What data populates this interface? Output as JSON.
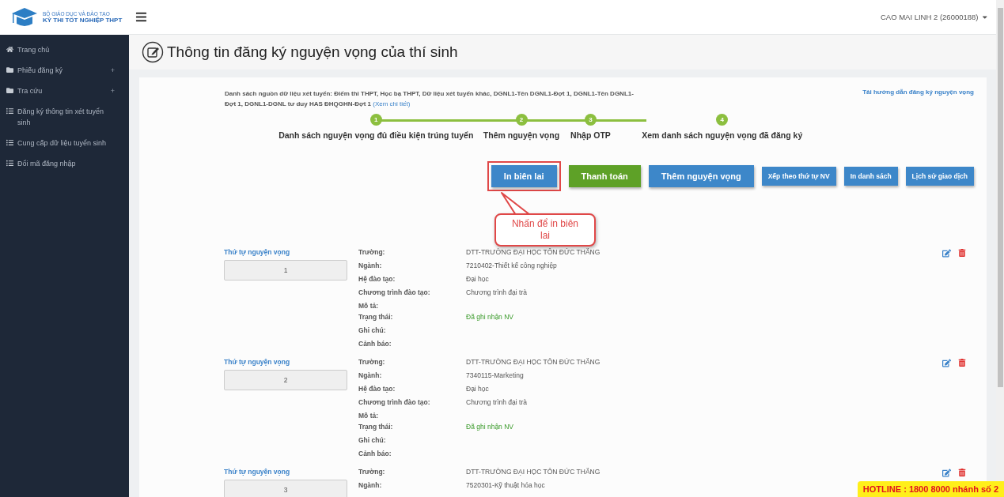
{
  "logo": {
    "ministry": "BỘ GIÁO DỤC VÀ ĐÀO TẠO",
    "exam": "KỲ THI TỐT NGHIỆP THPT"
  },
  "sidebar": {
    "items": [
      {
        "label": "Trang chủ",
        "kind": "home"
      },
      {
        "label": "Phiếu đăng ký",
        "kind": "folder",
        "toggle": "+"
      },
      {
        "label": "Tra cứu",
        "kind": "folder",
        "toggle": "+"
      },
      {
        "label": "Đăng ký thông tin xét tuyển sinh",
        "kind": "list"
      },
      {
        "label": "Cung cấp dữ liệu tuyển sinh",
        "kind": "list"
      },
      {
        "label": "Đổi mã đăng nhập",
        "kind": "list"
      }
    ]
  },
  "header": {
    "user": "CAO MAI LINH 2 (26000188)"
  },
  "page_title": "Thông tin đăng ký nguyện vọng của thí sinh",
  "sources": {
    "text": "Danh sách nguồn dữ liệu xét tuyển: Điểm thi THPT, Học bạ THPT, Dữ liệu xét tuyển khác, DGNL1-Tên DGNL1-Đợt 1, DGNL1-Tên DGNL1-Đợt 1, DGNL1-DGNL tư duy HAS ĐHQGHN-Đợt 1",
    "link": "(Xem chi tiết)"
  },
  "guide_link": "Tải hướng dẫn đăng ký nguyện vọng",
  "steps": [
    {
      "number": "1",
      "label": "Danh sách nguyện vọng đủ điều kiện trúng tuyển",
      "completed": true
    },
    {
      "number": "2",
      "label": "Thêm nguyện vọng",
      "completed": true
    },
    {
      "number": "3",
      "label": "Nhập OTP",
      "completed": true
    },
    {
      "number": "4",
      "label": "Xem danh sách nguyện vọng đã đăng ký",
      "completed": true
    }
  ],
  "buttons": [
    {
      "label": "In biên lai",
      "kind": "primary",
      "highlighted": true
    },
    {
      "label": "Thanh toán",
      "kind": "success",
      "highlighted": false
    },
    {
      "label": "Thêm nguyện vọng",
      "kind": "primary",
      "highlighted": false
    },
    {
      "label": "Xếp theo thứ tự NV",
      "kind": "compact",
      "highlighted": false
    },
    {
      "label": "In danh sách",
      "kind": "compact",
      "highlighted": false
    },
    {
      "label": "Lịch sử giao dịch",
      "kind": "compact",
      "highlighted": false
    }
  ],
  "callout": "Nhấn để in biên lai",
  "wishes": [
    {
      "order_label": "Thứ tự nguyện vọng",
      "order": "1",
      "fields": [
        {
          "label": "Trường:",
          "value": "DTT-TRƯỜNG ĐẠI HỌC TÔN ĐỨC THẮNG"
        },
        {
          "label": "Ngành:",
          "value": "7210402-Thiết kế công nghiệp"
        },
        {
          "label": "Hệ đào tạo:",
          "value": "Đại học"
        },
        {
          "label": "Chương trình đào tạo:",
          "value": "Chương trình đại trà"
        },
        {
          "label": "Mô tả:"
        },
        {
          "label": "Trạng thái:",
          "value": "Đã ghi nhận NV",
          "kind": "status"
        },
        {
          "label": "Ghi chú:"
        },
        {
          "label": "Cảnh báo:"
        }
      ]
    },
    {
      "order_label": "Thứ tự nguyện vọng",
      "order": "2",
      "fields": [
        {
          "label": "Trường:",
          "value": "DTT-TRƯỜNG ĐẠI HỌC TÔN ĐỨC THẮNG"
        },
        {
          "label": "Ngành:",
          "value": "7340115-Marketing"
        },
        {
          "label": "Hệ đào tạo:",
          "value": "Đại học"
        },
        {
          "label": "Chương trình đào tạo:",
          "value": "Chương trình đại trà"
        },
        {
          "label": "Mô tả:"
        },
        {
          "label": "Trạng thái:",
          "value": "Đã ghi nhận NV",
          "kind": "status"
        },
        {
          "label": "Ghi chú:"
        },
        {
          "label": "Cảnh báo:"
        }
      ]
    },
    {
      "order_label": "Thứ tự nguyện vọng",
      "order": "3",
      "fields": [
        {
          "label": "Trường:",
          "value": "DTT-TRƯỜNG ĐẠI HỌC TÔN ĐỨC THẮNG"
        },
        {
          "label": "Ngành:",
          "value": "7520301-Kỹ thuật hóa học"
        }
      ]
    }
  ],
  "hotline": "HOTLINE : 1800 8000 nhánh số 2"
}
